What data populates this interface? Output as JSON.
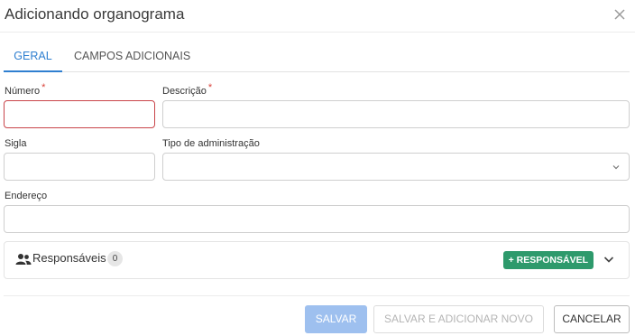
{
  "dialog": {
    "title": "Adicionando organograma"
  },
  "tabs": [
    {
      "label": "GERAL"
    },
    {
      "label": "CAMPOS ADICIONAIS"
    }
  ],
  "form": {
    "numero": {
      "label": "Número",
      "required_mark": "*",
      "value": ""
    },
    "descricao": {
      "label": "Descrição",
      "required_mark": "*",
      "value": ""
    },
    "sigla": {
      "label": "Sigla",
      "value": ""
    },
    "tipo_administracao": {
      "label": "Tipo de administração",
      "value": ""
    },
    "endereco": {
      "label": "Endereço",
      "value": ""
    }
  },
  "responsaveis": {
    "label": "Responsáveis",
    "count": "0",
    "add_button": "+ RESPONSÁVEL",
    "icon": "people-icon"
  },
  "footer": {
    "save": "SALVAR",
    "save_and_new": "SALVAR E ADICIONAR NOVO",
    "cancel": "CANCELAR"
  },
  "colors": {
    "accent": "#2f7fd0",
    "required": "#d9423a",
    "error_border": "#c9454a",
    "success": "#2e9a6c",
    "save_disabled": "#9ec0ef"
  }
}
